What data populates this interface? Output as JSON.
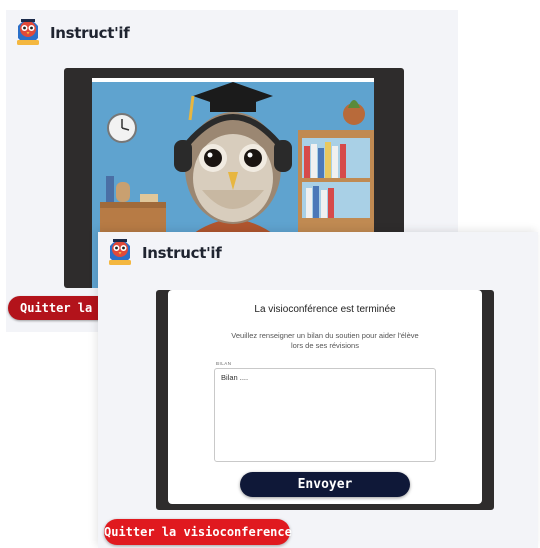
{
  "brand": {
    "name": "Instruct'if",
    "logo_icon": "owl-mascot-icon"
  },
  "colors": {
    "page_bg": "#f3f4f8",
    "video_frame": "#2e2c2c",
    "quit_back": "#b3131b",
    "quit_front": "#e0191f",
    "send_button": "#0f1838"
  },
  "back_screen": {
    "video_icon": "owl-tutor-video-icon",
    "quit_label": "Quitter la visioconference"
  },
  "front_screen": {
    "modal": {
      "title": "La visioconférence est terminée",
      "description": "Veuillez renseigner un bilan du soutien pour aider l'élève lors de ses révisions",
      "field_label": "BILAN",
      "textarea_value": "Bilan ....",
      "send_label": "Envoyer"
    },
    "quit_label": "Quitter la visioconference"
  }
}
